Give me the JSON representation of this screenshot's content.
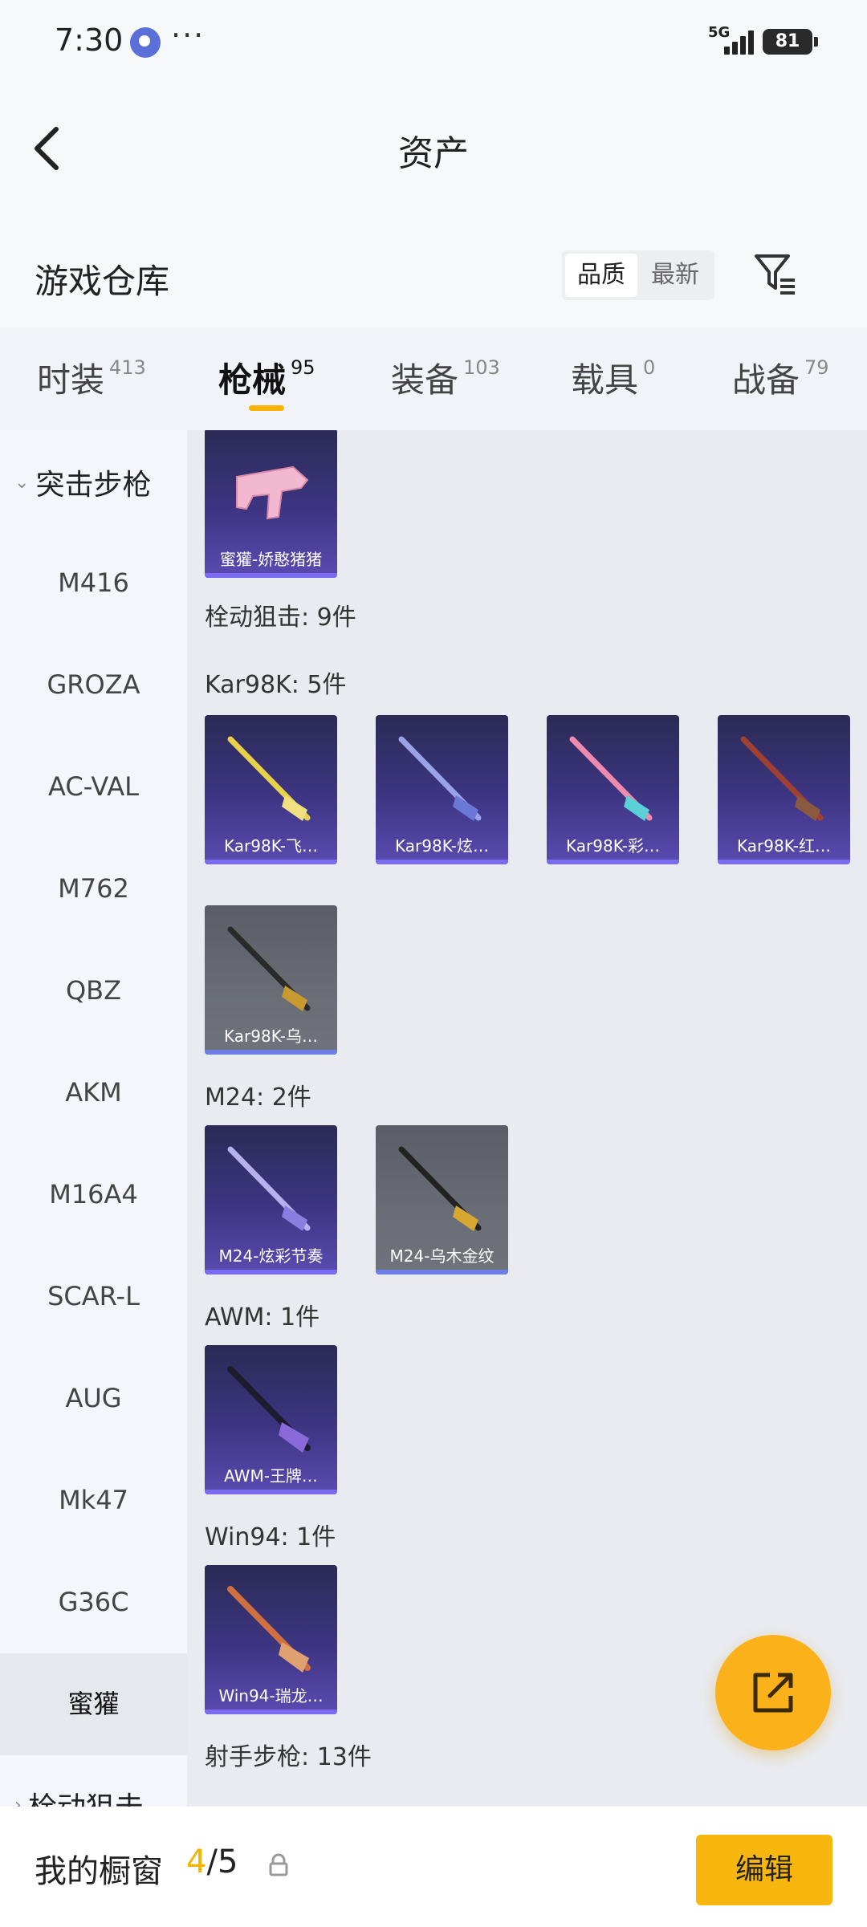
{
  "status_bar": {
    "time": "7:30",
    "more": "···",
    "network": "5G",
    "battery": "81"
  },
  "header": {
    "title": "资产",
    "back_icon": "chevron-left-icon"
  },
  "warehouse": {
    "title": "游戏仓库",
    "sort_options": [
      "品质",
      "最新"
    ],
    "selected_sort": "品质",
    "filter_icon": "filter-icon"
  },
  "tabs": [
    {
      "label": "时装",
      "count": "413"
    },
    {
      "label": "枪械",
      "count": "95"
    },
    {
      "label": "装备",
      "count": "103"
    },
    {
      "label": "载具",
      "count": "0"
    },
    {
      "label": "战备",
      "count": "79"
    }
  ],
  "active_tab": "枪械",
  "sidebar": {
    "group": "突击步枪",
    "items": [
      "M416",
      "GROZA",
      "AC-VAL",
      "M762",
      "QBZ",
      "AKM",
      "M16A4",
      "SCAR-L",
      "AUG",
      "Mk47",
      "G36C",
      "蜜獾"
    ],
    "active_item": "蜜獾",
    "next_group": "栓动狙击"
  },
  "content": {
    "top_card": {
      "name": "蜜獾-娇憨猪猪"
    },
    "category_heading": "栓动狙击: 9件",
    "sections": [
      {
        "title": "Kar98K: 5件",
        "cards": [
          {
            "name": "Kar98K-飞…"
          },
          {
            "name": "Kar98K-炫…"
          },
          {
            "name": "Kar98K-彩…"
          },
          {
            "name": "Kar98K-红…"
          },
          {
            "name": "Kar98K-乌…"
          }
        ]
      },
      {
        "title": "M24: 2件",
        "cards": [
          {
            "name": "M24-炫彩节奏"
          },
          {
            "name": "M24-乌木金纹"
          }
        ]
      },
      {
        "title": "AWM: 1件",
        "cards": [
          {
            "name": "AWM-王牌…"
          }
        ]
      },
      {
        "title": "Win94: 1件",
        "cards": [
          {
            "name": "Win94-瑞龙…"
          }
        ]
      }
    ],
    "next_heading": "射手步枪: 13件"
  },
  "fab_icon": "share-external-icon",
  "bottom_bar": {
    "label": "我的橱窗",
    "current": "4",
    "separator": "/",
    "total": "5",
    "lock_icon": "lock-icon",
    "edit_label": "编辑"
  },
  "colors": {
    "accent": "#f6b400",
    "card_purple": "#3d3583",
    "card_gray": "#6a6d75"
  }
}
